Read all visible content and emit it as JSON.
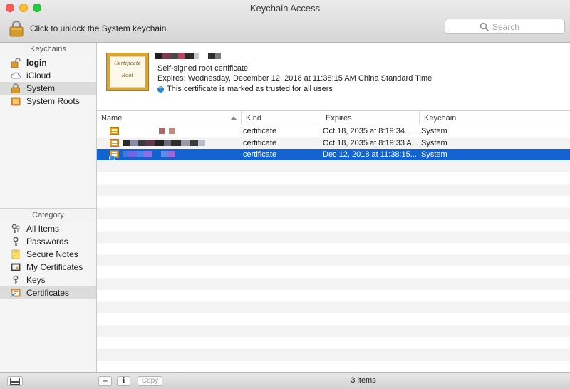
{
  "window": {
    "title": "Keychain Access"
  },
  "toolbar": {
    "lock_message": "Click to unlock the System keychain.",
    "search_placeholder": "Search"
  },
  "keychains": {
    "header": "Keychains",
    "items": [
      {
        "label": "login",
        "icon": "lock-open-icon",
        "bold": true
      },
      {
        "label": "iCloud",
        "icon": "cloud-icon"
      },
      {
        "label": "System",
        "icon": "lock-closed-icon",
        "selected": true
      },
      {
        "label": "System Roots",
        "icon": "keychain-box-icon"
      }
    ]
  },
  "category": {
    "header": "Category",
    "items": [
      {
        "label": "All Items",
        "icon": "key-icon"
      },
      {
        "label": "Passwords",
        "icon": "password-key-icon"
      },
      {
        "label": "Secure Notes",
        "icon": "note-icon"
      },
      {
        "label": "My Certificates",
        "icon": "certificate-icon"
      },
      {
        "label": "Keys",
        "icon": "single-key-icon"
      },
      {
        "label": "Certificates",
        "icon": "certificate-icon",
        "selected": true
      }
    ]
  },
  "detail": {
    "cert_image_line1": "Certificate",
    "cert_image_line2": "Root",
    "type_line": "Self-signed root certificate",
    "expires_line": "Expires: Wednesday, December 12, 2018 at 11:38:15 AM China Standard Time",
    "trust_line": "This certificate is marked as trusted for all users"
  },
  "table": {
    "columns": {
      "name": "Name",
      "kind": "Kind",
      "expires": "Expires",
      "keychain": "Keychain"
    },
    "rows": [
      {
        "kind": "certificate",
        "expires": "Oct 18, 2035 at 8:19:34...",
        "keychain": "System"
      },
      {
        "kind": "certificate",
        "expires": "Oct 18, 2035 at 8:19:33 A...",
        "keychain": "System"
      },
      {
        "kind": "certificate",
        "expires": "Dec 12, 2018 at 11:38:15...",
        "keychain": "System",
        "selected": true
      }
    ]
  },
  "bottom": {
    "add_label": "+",
    "info_label": "i",
    "copy_label": "Copy",
    "count_label": "3 items"
  },
  "colors": {
    "selection": "#1263d0",
    "sidebar_selection": "#dcdcdc",
    "lock_gold": "#d39a2e"
  }
}
